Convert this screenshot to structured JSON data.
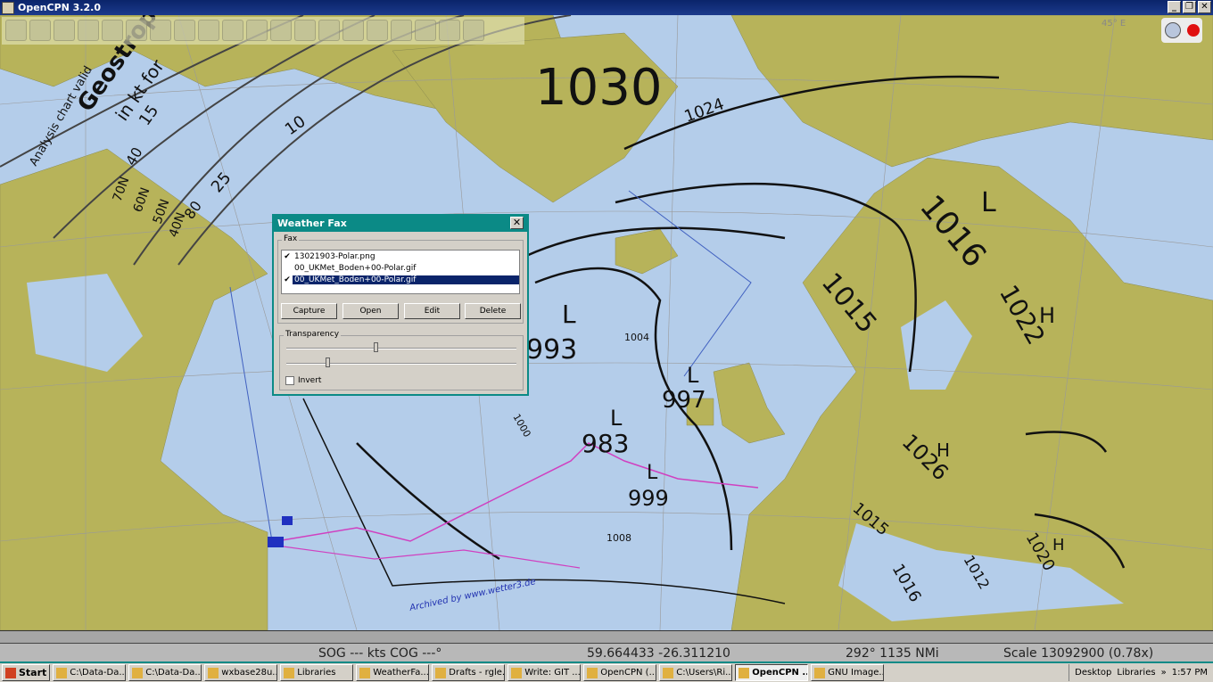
{
  "window": {
    "title": "OpenCPN 3.2.0",
    "buttons": [
      "_",
      "❐",
      "✕"
    ]
  },
  "toolbar": {
    "icons": [
      "zoom-in-icon",
      "zoom-out-icon",
      "scale-in-icon",
      "scale-out-icon",
      "route-icon",
      "waypoint-icon",
      "measure-icon",
      "track-icon",
      "auto-follow-icon",
      "chart-icon",
      "options-icon",
      "print-icon",
      "route-manager-icon",
      "track-toggle-icon",
      "color-scheme-icon",
      "ais-icon",
      "help-icon",
      "tides-icon",
      "currents-icon",
      "weatherfax-icon"
    ]
  },
  "map": {
    "labels": [
      "1030",
      "L",
      "993",
      "L",
      "983",
      "L",
      "997",
      "L",
      "999",
      "1016",
      "1015",
      "L",
      "1022",
      "H",
      "1026",
      "H",
      "1020",
      "H",
      "1015",
      "1016",
      "1012",
      "1024",
      "1004",
      "1000",
      "1008",
      "Geostrophic",
      "in kt for",
      "Analysis chart valid",
      "10",
      "15",
      "25",
      "40",
      "80",
      "70N",
      "60N",
      "50N",
      "40N",
      "Archived by www.wetter3.de",
      "45° E"
    ]
  },
  "dialog": {
    "title": "Weather Fax",
    "close": "✕",
    "fax_group": "Fax",
    "fax_list": [
      {
        "checked": true,
        "name": "13021903-Polar.png",
        "selected": false
      },
      {
        "checked": false,
        "name": "00_UKMet_Boden+00-Polar.gif",
        "selected": false
      },
      {
        "checked": true,
        "name": "00_UKMet_Boden+00-Polar.gif",
        "selected": true
      }
    ],
    "check_mark": "✔",
    "buttons": {
      "capture": "Capture",
      "open": "Open",
      "edit": "Edit",
      "delete": "Delete"
    },
    "transparency_label": "Transparency",
    "transparency_value": 0.38,
    "whitening_value": 0.17,
    "invert_label": "Invert",
    "invert_checked": false
  },
  "status": {
    "sog": "SOG --- kts  COG ---°",
    "position": "59.664433   -26.311210",
    "bearing": "292°  1135 NMi",
    "scale": "Scale 13092900 (0.78x)"
  },
  "taskbar": {
    "start": "Start",
    "tasks": [
      "C:\\Data-Da...",
      "C:\\Data-Da...",
      "wxbase28u...",
      "Libraries",
      "WeatherFa...",
      "Drafts - rgle...",
      "Write: GIT ...",
      "OpenCPN (...",
      "C:\\Users\\Ri...",
      "OpenCPN ...",
      "GNU Image..."
    ],
    "active_index": 9,
    "desktop": "Desktop",
    "libraries": "Libraries",
    "chevron": "»",
    "clock": "1:57 PM"
  },
  "colors": {
    "sea": "#b4cdea",
    "land": "#b7b35a",
    "titlebar": "#0a246a",
    "dialog_title": "#0b8a86",
    "route": "#d040c0"
  }
}
